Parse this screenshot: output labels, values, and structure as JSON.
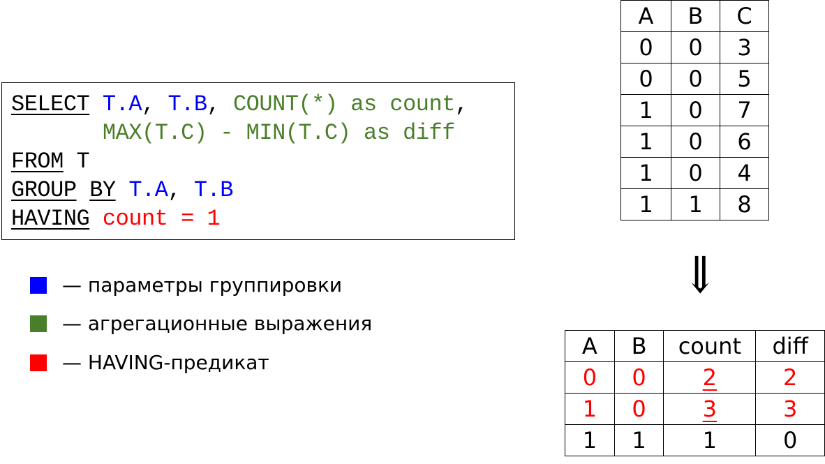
{
  "code": {
    "line1": {
      "kw": "SELECT",
      "g1": "T.A",
      "sep1": ", ",
      "g2": "T.B",
      "sep2": ", ",
      "agg1": "COUNT(*) as count",
      "end": ","
    },
    "line2": {
      "indent": "       ",
      "agg2": "MAX(T.C) - MIN(T.C) as diff"
    },
    "line3": {
      "kw": "FROM",
      "rest": " T"
    },
    "line4": {
      "kw1": "GROUP",
      "kw2": "BY",
      "g1": "T.A",
      "sep": ", ",
      "g2": "T.B"
    },
    "line5": {
      "kw": "HAVING",
      "pred": "count = 1"
    }
  },
  "colors": {
    "group": "#0000ff",
    "aggregate": "#4a7f2a",
    "having": "#ff0000"
  },
  "legend": [
    {
      "color": "#0000ff",
      "label": "— параметры группировки"
    },
    {
      "color": "#4a7f2a",
      "label": "— агрегационные выражения"
    },
    {
      "color": "#ff0000",
      "label": "— HAVING-предикат"
    }
  ],
  "source_table": {
    "headers": [
      "A",
      "B",
      "C"
    ],
    "rows": [
      [
        "0",
        "0",
        "3"
      ],
      [
        "0",
        "0",
        "5"
      ],
      [
        "1",
        "0",
        "7"
      ],
      [
        "1",
        "0",
        "6"
      ],
      [
        "1",
        "0",
        "4"
      ],
      [
        "1",
        "1",
        "8"
      ]
    ]
  },
  "arrow": "⇓",
  "result_table": {
    "headers": [
      "A",
      "B",
      "count",
      "diff"
    ],
    "rows": [
      [
        "0",
        "0",
        "2",
        "2"
      ],
      [
        "1",
        "0",
        "3",
        "3"
      ],
      [
        "1",
        "1",
        "1",
        "0"
      ]
    ],
    "filtered_out": [
      true,
      true,
      false
    ]
  }
}
